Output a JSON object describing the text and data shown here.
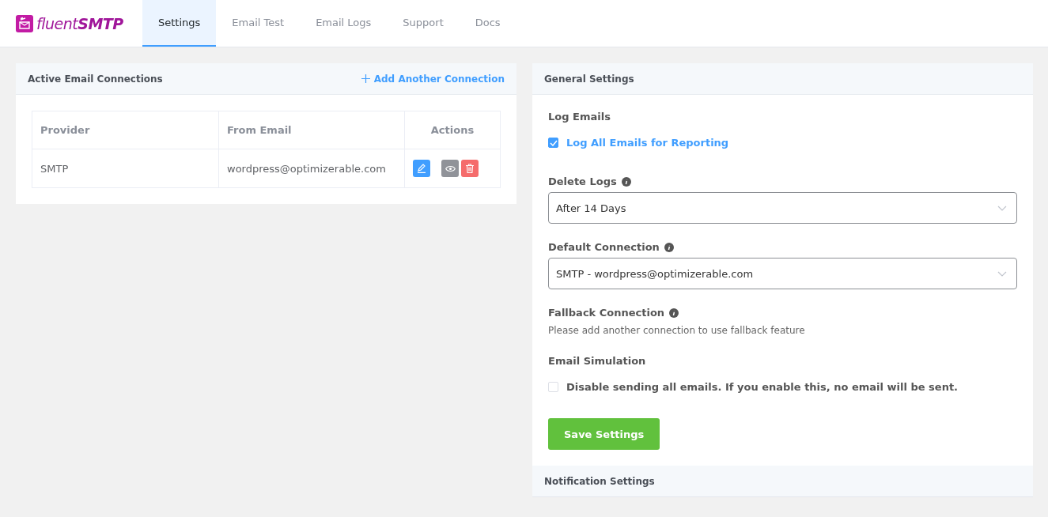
{
  "logo": {
    "text": "fluent**SMTP**"
  },
  "tabs": [
    {
      "label": "Settings",
      "selected": true
    },
    {
      "label": "Email Test",
      "selected": false
    },
    {
      "label": "Email Logs",
      "selected": false
    },
    {
      "label": "Support",
      "selected": false
    },
    {
      "label": "Docs",
      "selected": false
    }
  ],
  "connections": {
    "title": "Active Email Connections",
    "add_link": "Add Another Connection",
    "columns": [
      "Provider",
      "From Email",
      "Actions"
    ],
    "rows": [
      {
        "provider": "SMTP",
        "from_email": "wordpress@optimizerable.com"
      }
    ]
  },
  "general": {
    "title": "General Settings",
    "log_emails": {
      "label": "Log Emails",
      "option": "Log All Emails for Reporting",
      "checked": true
    },
    "delete_logs": {
      "label": "Delete Logs",
      "value": "After 14 Days"
    },
    "default_connection": {
      "label": "Default Connection",
      "value": "SMTP - wordpress@optimizerable.com"
    },
    "fallback": {
      "label": "Fallback Connection",
      "note": "Please add another connection to use fallback feature"
    },
    "simulation": {
      "label": "Email Simulation",
      "option": "Disable sending all emails. If you enable this, no email will be sent.",
      "checked": false
    },
    "save_button": "Save Settings"
  },
  "notification": {
    "title": "Notification Settings"
  }
}
